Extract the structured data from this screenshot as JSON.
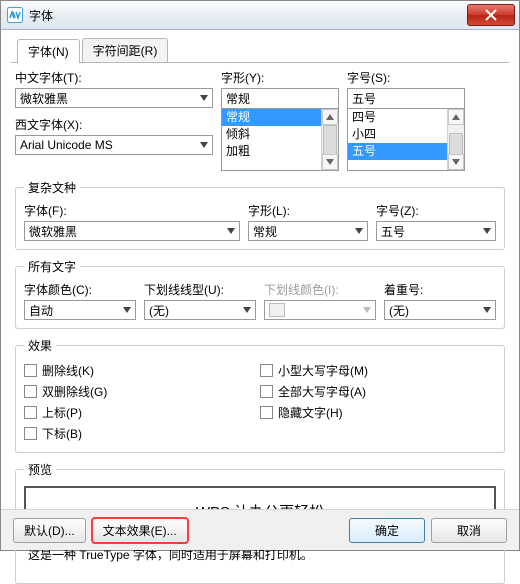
{
  "title": "字体",
  "tabs": {
    "font": "字体(N)",
    "spacing": "字符间距(R)"
  },
  "main": {
    "chinese_font_label": "中文字体(T):",
    "chinese_font_value": "微软雅黑",
    "western_font_label": "西文字体(X):",
    "western_font_value": "Arial Unicode MS",
    "style_label": "字形(Y):",
    "style_value": "常规",
    "style_list": [
      "常规",
      "倾斜",
      "加粗"
    ],
    "size_label": "字号(S):",
    "size_value": "五号",
    "size_list": [
      "四号",
      "小四",
      "五号"
    ],
    "size_selected_index": 2
  },
  "complex": {
    "legend": "复杂文种",
    "font_label": "字体(F):",
    "font_value": "微软雅黑",
    "style_label": "字形(L):",
    "style_value": "常规",
    "size_label": "字号(Z):",
    "size_value": "五号"
  },
  "alltext": {
    "legend": "所有文字",
    "color_label": "字体颜色(C):",
    "color_value": "自动",
    "underline_label": "下划线线型(U):",
    "underline_value": "(无)",
    "ul_color_label": "下划线颜色(I):",
    "ul_color_value": "",
    "emphasis_label": "着重号:",
    "emphasis_value": "(无)"
  },
  "effects": {
    "legend": "效果",
    "strike": "删除线(K)",
    "dstrike": "双删除线(G)",
    "sup": "上标(P)",
    "sub": "下标(B)",
    "smallcaps": "小型大写字母(M)",
    "allcaps": "全部大写字母(A)",
    "hidden": "隐藏文字(H)"
  },
  "preview": {
    "legend": "预览",
    "text": "WPS 让办公更轻松",
    "hint": "这是一种 TrueType 字体，同时适用于屏幕和打印机。"
  },
  "footer": {
    "default": "默认(D)...",
    "text_effect": "文本效果(E)...",
    "ok": "确定",
    "cancel": "取消"
  }
}
